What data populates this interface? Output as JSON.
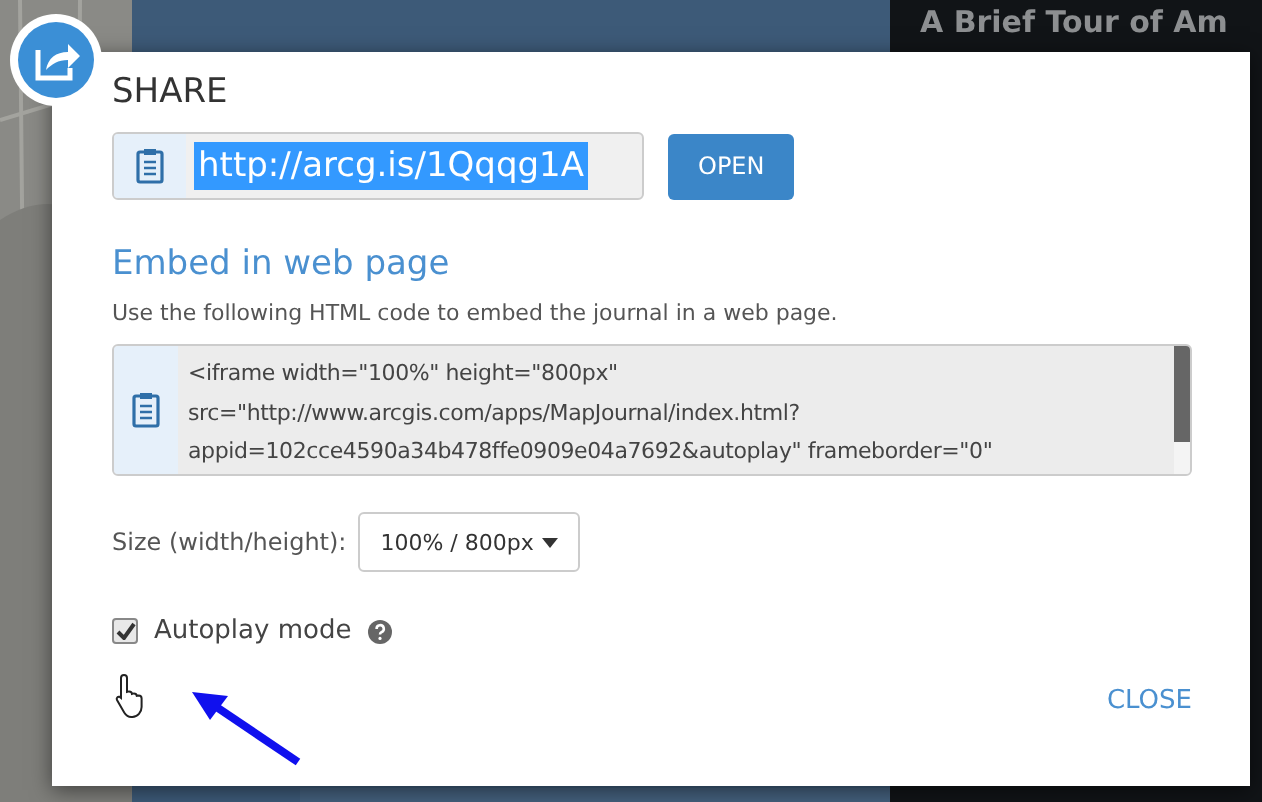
{
  "backdrop": {
    "title": "A Brief Tour of Am"
  },
  "dialog": {
    "title": "SHARE",
    "link": {
      "value": "http://arcg.is/1Qqqg1A",
      "selected": true
    },
    "open_button": "OPEN",
    "embed": {
      "heading": "Embed in web page",
      "description": "Use the following HTML code to embed the journal in a web page.",
      "code": "<iframe width=\"100%\" height=\"800px\"\nsrc=\"http://www.arcgis.com/apps/MapJournal/index.html?\nappid=102cce4590a34b478ffe0909e04a7692&autoplay\" frameborder=\"0\""
    },
    "size": {
      "label": "Size (width/height):",
      "value": "100% / 800px"
    },
    "autoplay": {
      "label": "Autoplay mode",
      "checked": true
    },
    "close_button": "CLOSE"
  }
}
